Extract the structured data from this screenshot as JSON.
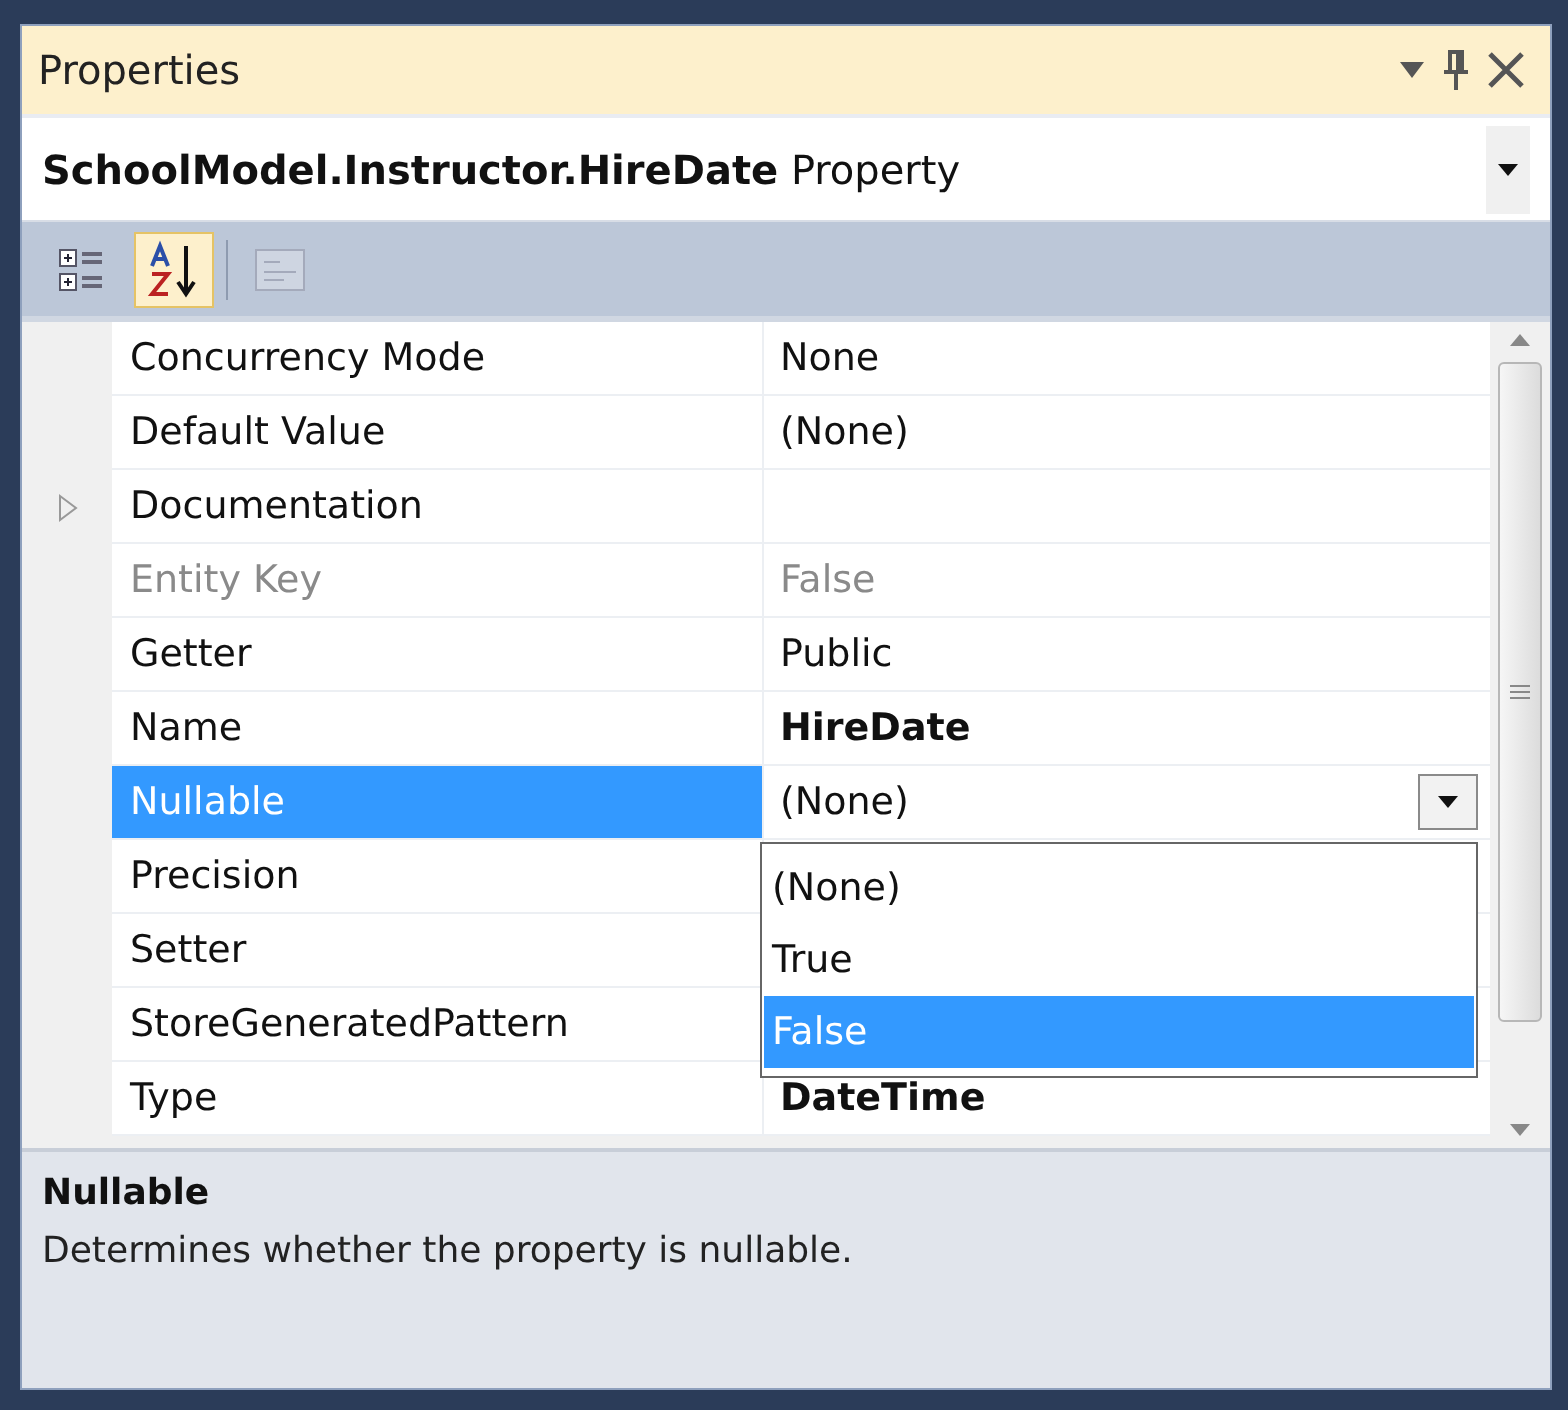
{
  "window": {
    "title": "Properties"
  },
  "object_selector": {
    "name": "SchoolModel.Instructor.HireDate",
    "type": "Property"
  },
  "toolbar": [
    {
      "kind": "categorized",
      "selected": false,
      "disabled": false
    },
    {
      "kind": "alphabetical",
      "selected": true,
      "disabled": false
    },
    {
      "kind": "pages",
      "selected": false,
      "disabled": true
    }
  ],
  "properties": [
    {
      "name": "Concurrency Mode",
      "value": "None",
      "kind": "property",
      "selected": false,
      "disabled": false,
      "modified": false
    },
    {
      "name": "Default Value",
      "value": "(None)",
      "kind": "property",
      "selected": false,
      "disabled": false,
      "modified": false
    },
    {
      "name": "Documentation",
      "kind": "expandable",
      "selected": false,
      "disabled": false
    },
    {
      "name": "Entity Key",
      "value": "False",
      "kind": "property",
      "selected": false,
      "disabled": true,
      "modified": false
    },
    {
      "name": "Getter",
      "value": "Public",
      "kind": "property",
      "selected": false,
      "disabled": false,
      "modified": false
    },
    {
      "name": "Name",
      "value": "HireDate",
      "kind": "property",
      "selected": false,
      "disabled": false,
      "modified": true
    },
    {
      "name": "Nullable",
      "value": "(None)",
      "kind": "dropdown",
      "selected": true,
      "disabled": false,
      "modified": false
    },
    {
      "name": "Precision",
      "kind": "property",
      "selected": false,
      "disabled": false
    },
    {
      "name": "Setter",
      "kind": "property",
      "selected": false,
      "disabled": false
    },
    {
      "name": "StoreGeneratedPattern",
      "kind": "property",
      "selected": false,
      "disabled": false
    },
    {
      "name": "Type",
      "value": "DateTime",
      "kind": "property",
      "selected": false,
      "disabled": false,
      "modified": true
    }
  ],
  "dropdown_options": [
    {
      "label": "(None)",
      "selected": false
    },
    {
      "label": "True",
      "selected": false
    },
    {
      "label": "False",
      "selected": true
    }
  ],
  "description": {
    "title": "Nullable",
    "text": "Determines whether the property is nullable."
  }
}
